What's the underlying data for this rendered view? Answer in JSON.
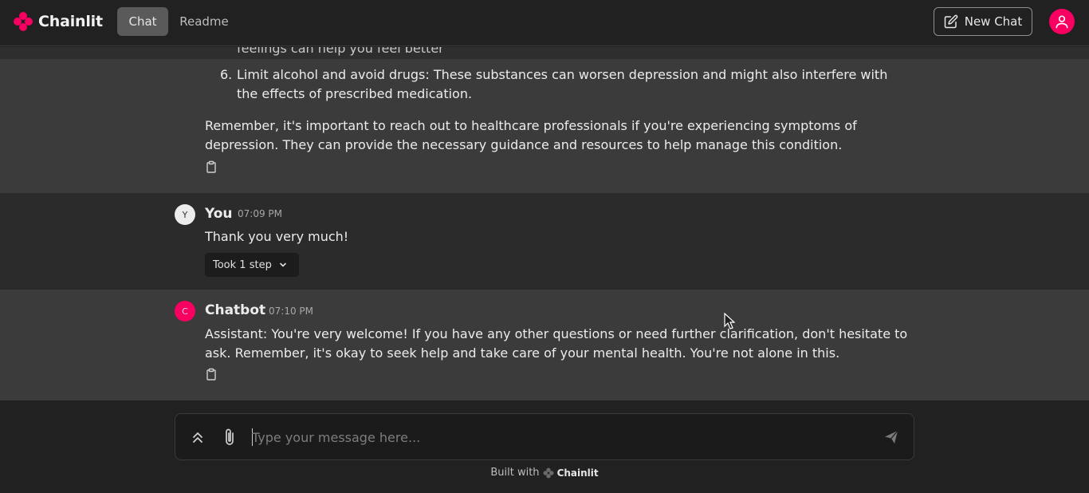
{
  "header": {
    "brand": "Chainlit",
    "tabs": [
      "Chat",
      "Readme"
    ],
    "new_chat_label": "New Chat"
  },
  "messages": {
    "partial_line": "feelings can help you feel better",
    "list_item_number": "6.",
    "list_item_text": "Limit alcohol and avoid drugs: These substances can worsen depression and might also interfere with the effects of prescribed medication.",
    "closing_text": "Remember, it's important to reach out to healthcare professionals if you're experiencing symptoms of depression. They can provide the necessary guidance and resources to help manage this condition.",
    "user": {
      "initial": "Y",
      "author": "You",
      "time": "07:09 PM",
      "text": "Thank you very much!",
      "steps_label": "Took 1 step"
    },
    "bot": {
      "initial": "C",
      "author": "Chatbot",
      "time": "07:10 PM",
      "text": "Assistant: You're very welcome! If you have any other questions or need further clarification, don't hesitate to ask. Remember, it's okay to seek help and take care of your mental health. You're not alone in this."
    }
  },
  "composer": {
    "placeholder": "Type your message here..."
  },
  "footer": {
    "prefix": "Built with",
    "brand": "Chainlit"
  },
  "colors": {
    "accent": "#F80061",
    "background": "#212121",
    "message_alt": "#3b3b3b"
  }
}
